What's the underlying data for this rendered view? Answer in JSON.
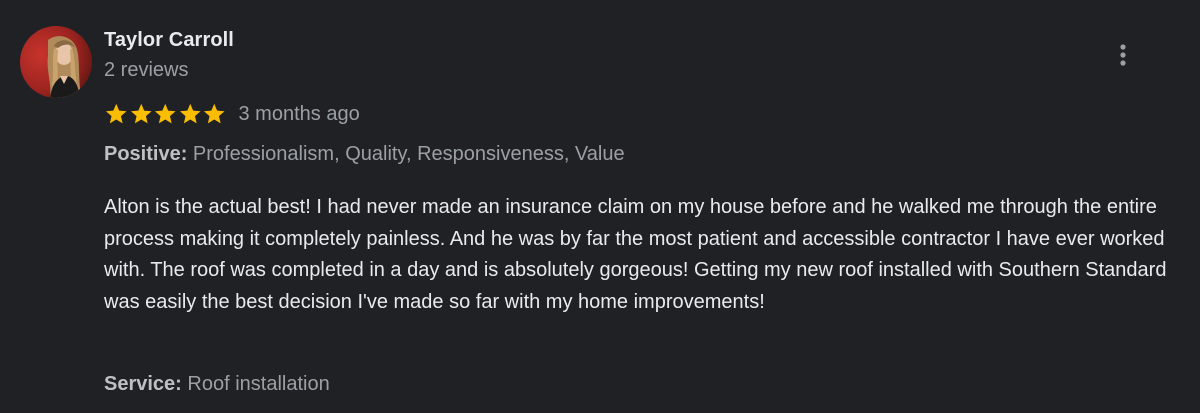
{
  "reviewer": {
    "name": "Taylor Carroll",
    "review_count": "2 reviews",
    "avatar_icon": "user-photo-avatar"
  },
  "rating": {
    "stars": 5,
    "max_stars": 5,
    "star_color": "#fbbc04",
    "time_ago": "3 months ago"
  },
  "aspects": {
    "label": "Positive:",
    "value": " Professionalism, Quality, Responsiveness, Value"
  },
  "review": {
    "text": "Alton is the actual best! I had never made an insurance claim on my house before and he walked me through the entire process making it completely painless. And he was by far the most patient and accessible contractor I have ever worked with. The roof was completed in a day and is absolutely gorgeous! Getting my new roof installed with Southern Standard was easily the best decision I've made so far with my home improvements!"
  },
  "service": {
    "label": "Service:",
    "value": " Roof installation"
  },
  "menu": {
    "icon": "more-vert-icon"
  },
  "colors": {
    "background": "#202124",
    "primary_text": "#e8eaed",
    "secondary_text": "#9aa0a6"
  }
}
